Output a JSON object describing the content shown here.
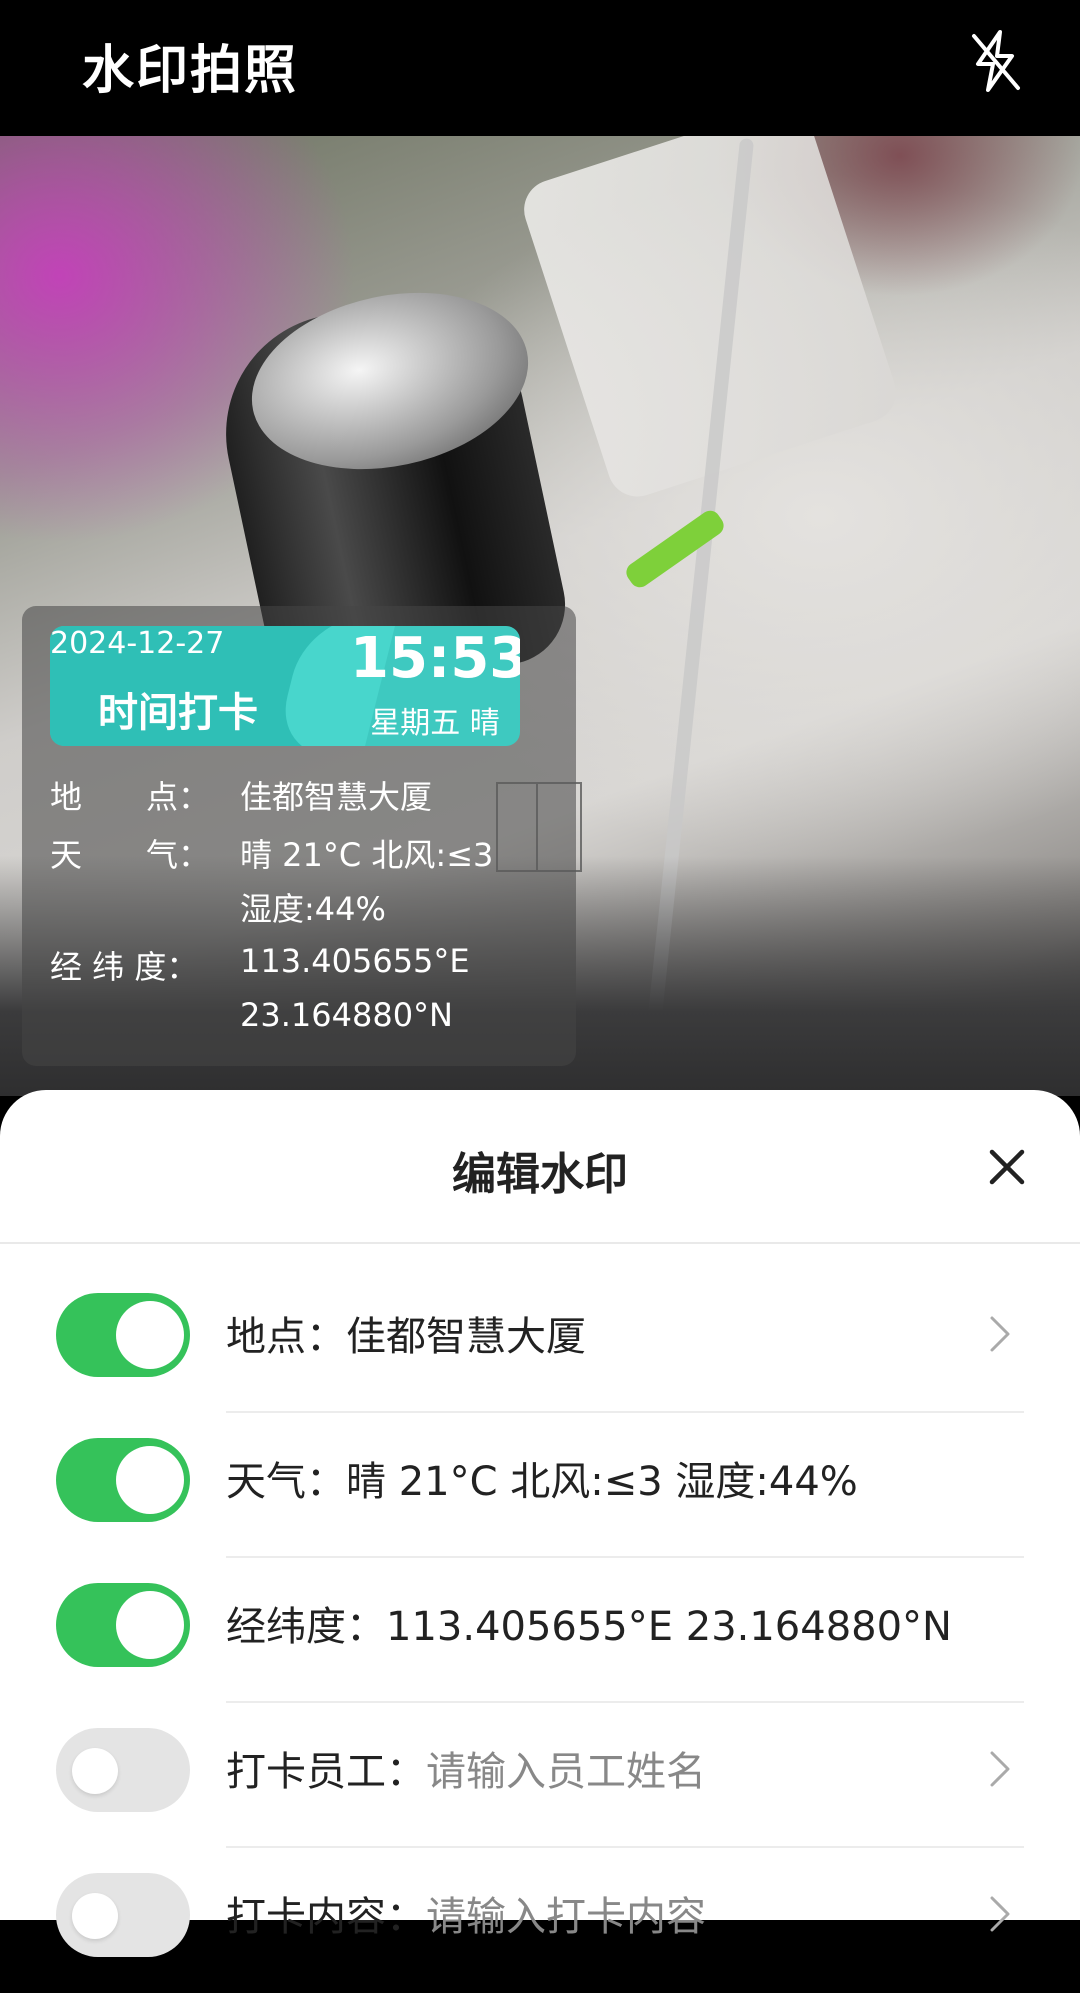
{
  "app": {
    "title": "水印拍照"
  },
  "watermark": {
    "date": "2024-12-27",
    "title": "时间打卡",
    "time": "15:53",
    "weekday_weather": "星期五 晴",
    "rows": [
      {
        "key": "地　　点：",
        "value": "佳都智慧大厦"
      },
      {
        "key": "天　　气：",
        "value": "晴 21°C 北风:≤3",
        "value2": "湿度:44%"
      },
      {
        "key": "经 纬 度：",
        "value": "113.405655°E",
        "value2": "23.164880°N"
      }
    ]
  },
  "sheet": {
    "title": "编辑水印",
    "items": [
      {
        "label": "地点：",
        "value": "佳都智慧大厦",
        "placeholder": "",
        "enabled": true,
        "has_arrow": true
      },
      {
        "label": "天气：",
        "value": "晴 21°C 北风:≤3 湿度:44%",
        "placeholder": "",
        "enabled": true,
        "has_arrow": false
      },
      {
        "label": "经纬度：",
        "value": "113.405655°E 23.164880°N",
        "placeholder": "",
        "enabled": true,
        "has_arrow": false
      },
      {
        "label": "打卡员工：",
        "value": "",
        "placeholder": "请输入员工姓名",
        "enabled": false,
        "has_arrow": true
      },
      {
        "label": "打卡内容：",
        "value": "",
        "placeholder": "请输入打卡内容",
        "enabled": false,
        "has_arrow": true
      }
    ]
  },
  "colors": {
    "toggle_on": "#35c25a",
    "toggle_off": "#e4e4e4",
    "watermark_teal": "#3ec9c0"
  },
  "icons": {
    "flash": "flash-off-icon",
    "close": "close-icon",
    "arrow": "chevron-right-icon"
  }
}
